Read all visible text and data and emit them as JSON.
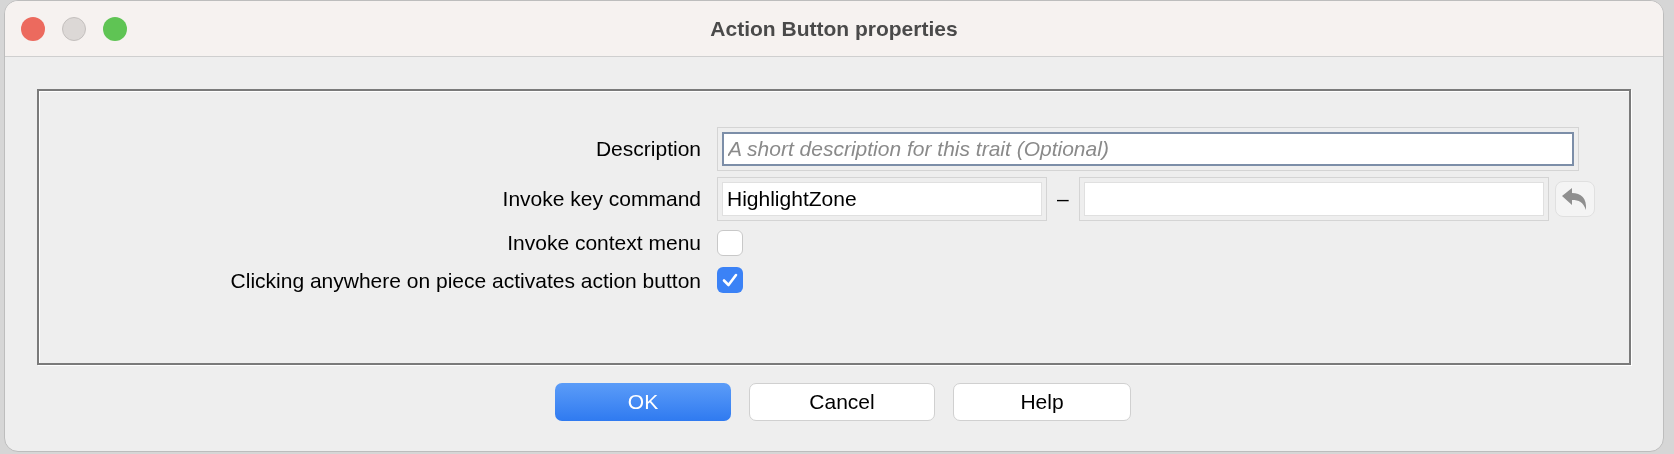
{
  "window": {
    "title": "Action Button properties"
  },
  "fields": [
    {
      "kind": "text",
      "label": "Description",
      "placeholder": "A short description for this trait (Optional)",
      "focused": true
    },
    {
      "kind": "key",
      "label": "Invoke key command",
      "value": "HighlightZone",
      "separator": "–"
    },
    {
      "kind": "check",
      "label": "Invoke context menu",
      "checked": false
    },
    {
      "kind": "check",
      "label": "Clicking anywhere on piece activates action button",
      "checked": true
    }
  ],
  "buttons": [
    {
      "label": "OK",
      "default": true
    },
    {
      "label": "Cancel",
      "default": false
    },
    {
      "label": "Help",
      "default": false
    }
  ]
}
